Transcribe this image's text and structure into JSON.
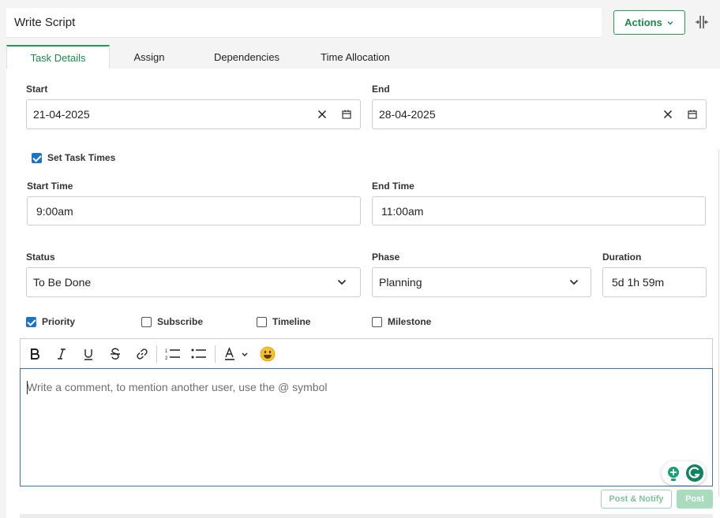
{
  "header": {
    "title": "Write Script",
    "actions_label": "Actions",
    "actions_icon": "chevron-down-icon",
    "split_icon": "split-view-icon"
  },
  "tabs": [
    {
      "label": "Task Details",
      "active": true
    },
    {
      "label": "Assign",
      "active": false
    },
    {
      "label": "Dependencies",
      "active": false
    },
    {
      "label": "Time Allocation",
      "active": false
    }
  ],
  "dates": {
    "start_label": "Start",
    "start_value": "21-04-2025",
    "end_label": "End",
    "end_value": "28-04-2025"
  },
  "set_task_times": {
    "label": "Set Task Times",
    "checked": true
  },
  "times": {
    "start_label": "Start Time",
    "start_value": "9:00am",
    "end_label": "End Time",
    "end_value": "11:00am"
  },
  "status": {
    "label": "Status",
    "value": "To Be Done"
  },
  "phase": {
    "label": "Phase",
    "value": "Planning"
  },
  "duration": {
    "label": "Duration",
    "value": "5d 1h 59m"
  },
  "flags": [
    {
      "label": "Priority",
      "checked": true
    },
    {
      "label": "Subscribe",
      "checked": false
    },
    {
      "label": "Timeline",
      "checked": false
    },
    {
      "label": "Milestone",
      "checked": false
    }
  ],
  "toolbar": {
    "buttons": [
      "bold-icon",
      "italic-icon",
      "underline-icon",
      "strikethrough-icon",
      "link-icon",
      "ordered-list-icon",
      "bullet-list-icon",
      "text-color-icon",
      "emoji-icon"
    ]
  },
  "comment": {
    "placeholder": "Write a comment, to mention another user, use the @ symbol"
  },
  "buttons": {
    "post_notify": "Post & Notify",
    "post": "Post"
  },
  "colors": {
    "accent_green": "#1f9d57",
    "checkbox_blue": "#1a73c9",
    "editor_border": "#3b6fb6"
  }
}
